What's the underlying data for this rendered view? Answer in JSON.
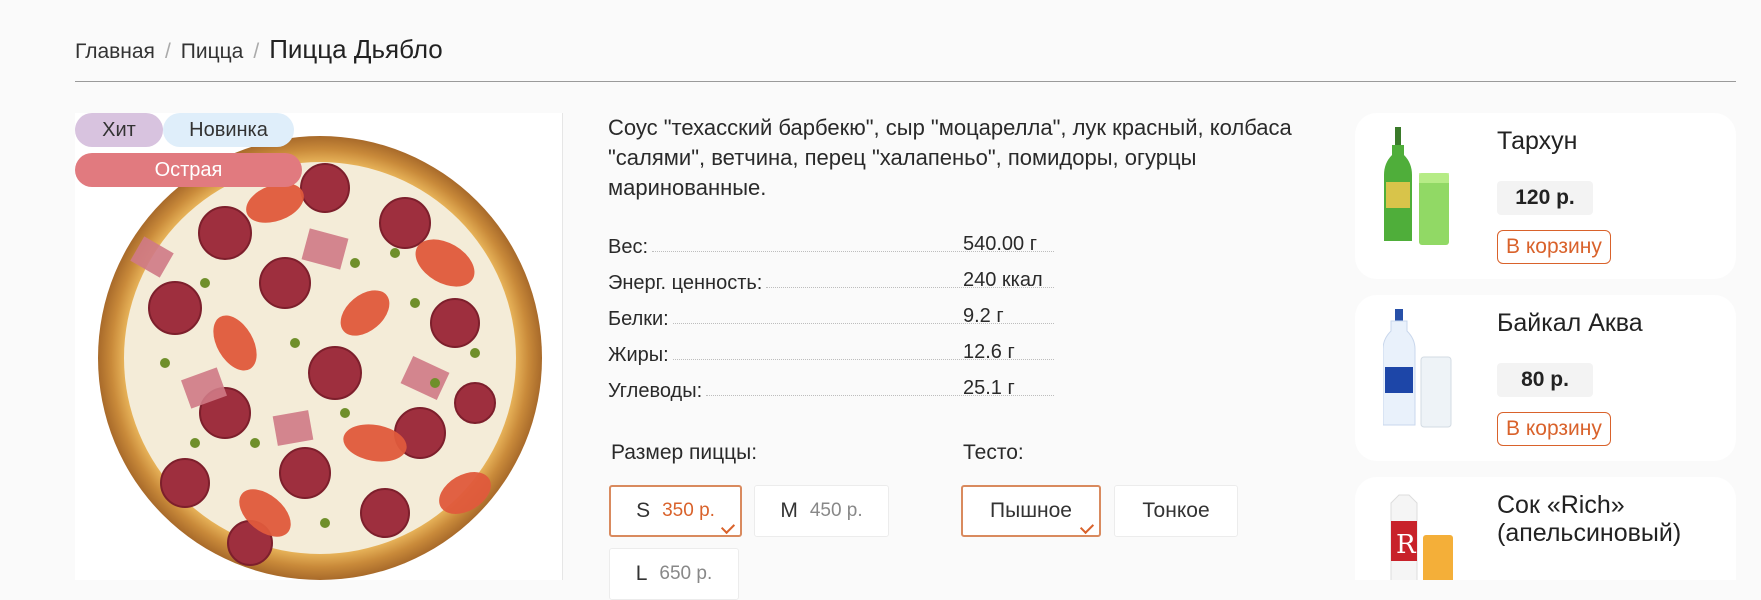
{
  "breadcrumb": {
    "home": "Главная",
    "category": "Пицца",
    "current": "Пицца Дьябло"
  },
  "product": {
    "badges": {
      "hit": "Хит",
      "new": "Новинка",
      "hot": "Острая"
    },
    "description": "Соус \"техасский барбекю\", сыр \"моцарелла\", лук красный, колбаса \"салями\", ветчина, перец \"халапеньо\", помидоры, огурцы маринованные.",
    "nutrition": [
      {
        "label": "Вес:",
        "value": "540.00 г"
      },
      {
        "label": "Энерг. ценность:",
        "value": "240 ккал"
      },
      {
        "label": "Белки:",
        "value": "9.2 г"
      },
      {
        "label": "Жиры:",
        "value": "12.6 г"
      },
      {
        "label": "Углеводы:",
        "value": "25.1 г"
      }
    ],
    "size": {
      "title": "Размер пиццы:",
      "options": [
        {
          "label": "S",
          "price": "350 р.",
          "selected": true
        },
        {
          "label": "M",
          "price": "450 р.",
          "selected": false
        },
        {
          "label": "L",
          "price": "650 р.",
          "selected": false
        }
      ]
    },
    "dough": {
      "title": "Тесто:",
      "options": [
        {
          "label": "Пышное",
          "selected": true
        },
        {
          "label": "Тонкое",
          "selected": false
        }
      ]
    }
  },
  "recommendations": [
    {
      "name": "Тархун",
      "price": "120 р.",
      "button": "В корзину",
      "icon": "tarhun-bottle-icon"
    },
    {
      "name": "Байкал Аква",
      "price": "80 р.",
      "button": "В корзину",
      "icon": "water-bottle-icon"
    },
    {
      "name": "Сок «Rich»\n(апельсиновый)",
      "price": "",
      "button": "",
      "icon": "juice-pack-icon"
    }
  ],
  "colors": {
    "accent": "#d9622b",
    "hit": "#d8c3df",
    "new": "#dfeefa",
    "hot": "#e17a7f"
  }
}
